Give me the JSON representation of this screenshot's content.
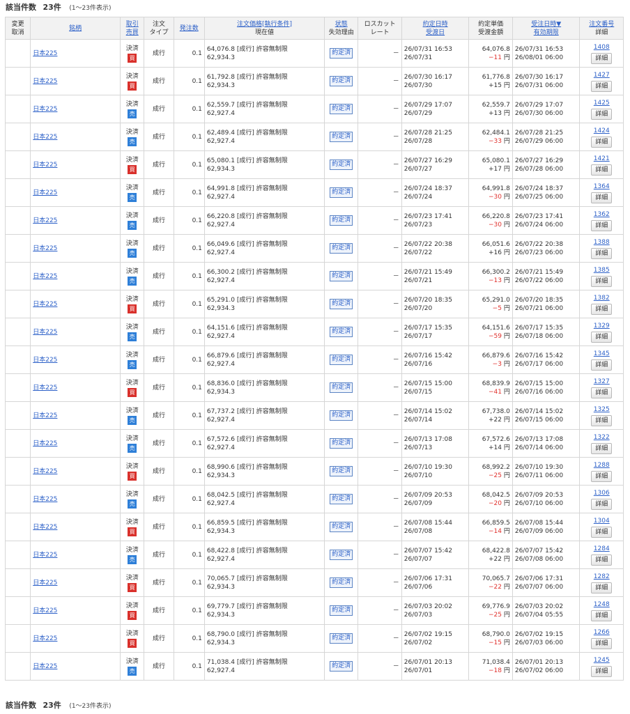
{
  "summary": {
    "label": "該当件数",
    "count": "23件",
    "range": "(1〜23件表示)"
  },
  "headers": {
    "change": [
      "変更",
      "取消"
    ],
    "symbol": "銘柄",
    "side": [
      "取引",
      "売買"
    ],
    "type": [
      "注文",
      "タイプ"
    ],
    "qty": "発注数",
    "price": [
      "注文価格[執行条件]",
      "現在値"
    ],
    "status": [
      "状態",
      "失効理由"
    ],
    "losscut": [
      "ロスカット",
      "レート"
    ],
    "exec_date": [
      "約定日時",
      "受渡日"
    ],
    "exec_price": [
      "約定単価",
      "受渡金額"
    ],
    "order_date": [
      "受注日時▼",
      "有効期限"
    ],
    "order_no": [
      "注文番号",
      "詳細"
    ]
  },
  "common": {
    "symbol": "日本225",
    "kesai": "決済",
    "buy": "買",
    "sell": "売",
    "type": "成行",
    "qty": "0.1",
    "condition": "[成行] 許容無制限",
    "status": "約定済",
    "losscut": "－",
    "yen": "円",
    "detail": "詳細"
  },
  "colors": {
    "buy": "#d9302b",
    "sell": "#2e7fd8",
    "link": "#2c60c8",
    "negative": "#e0312d"
  },
  "rows": [
    {
      "side": "buy",
      "price": "64,076.8",
      "current": "62,934.3",
      "exec_dt": "26/07/31 16:53",
      "settle": "26/07/31",
      "exec_price": "64,076.8",
      "pl": "−11",
      "neg": true,
      "order_dt": "26/07/31 16:53",
      "expiry": "26/08/01 06:00",
      "no": "1408"
    },
    {
      "side": "buy",
      "price": "61,792.8",
      "current": "62,934.3",
      "exec_dt": "26/07/30 16:17",
      "settle": "26/07/30",
      "exec_price": "61,776.8",
      "pl": "+15",
      "neg": false,
      "order_dt": "26/07/30 16:17",
      "expiry": "26/07/31 06:00",
      "no": "1427"
    },
    {
      "side": "sell",
      "price": "62,559.7",
      "current": "62,927.4",
      "exec_dt": "26/07/29 17:07",
      "settle": "26/07/29",
      "exec_price": "62,559.7",
      "pl": "+13",
      "neg": false,
      "order_dt": "26/07/29 17:07",
      "expiry": "26/07/30 06:00",
      "no": "1425"
    },
    {
      "side": "sell",
      "price": "62,489.4",
      "current": "62,927.4",
      "exec_dt": "26/07/28 21:25",
      "settle": "26/07/28",
      "exec_price": "62,484.1",
      "pl": "−33",
      "neg": true,
      "order_dt": "26/07/28 21:25",
      "expiry": "26/07/29 06:00",
      "no": "1424"
    },
    {
      "side": "buy",
      "price": "65,080.1",
      "current": "62,934.3",
      "exec_dt": "26/07/27 16:29",
      "settle": "26/07/27",
      "exec_price": "65,080.1",
      "pl": "+17",
      "neg": false,
      "order_dt": "26/07/27 16:29",
      "expiry": "26/07/28 06:00",
      "no": "1421"
    },
    {
      "side": "sell",
      "price": "64,991.8",
      "current": "62,927.4",
      "exec_dt": "26/07/24 18:37",
      "settle": "26/07/24",
      "exec_price": "64,991.8",
      "pl": "−30",
      "neg": true,
      "order_dt": "26/07/24 18:37",
      "expiry": "26/07/25 06:00",
      "no": "1364"
    },
    {
      "side": "sell",
      "price": "66,220.8",
      "current": "62,927.4",
      "exec_dt": "26/07/23 17:41",
      "settle": "26/07/23",
      "exec_price": "66,220.8",
      "pl": "−30",
      "neg": true,
      "order_dt": "26/07/23 17:41",
      "expiry": "26/07/24 06:00",
      "no": "1362"
    },
    {
      "side": "sell",
      "price": "66,049.6",
      "current": "62,927.4",
      "exec_dt": "26/07/22 20:38",
      "settle": "26/07/22",
      "exec_price": "66,051.6",
      "pl": "+16",
      "neg": false,
      "order_dt": "26/07/22 20:38",
      "expiry": "26/07/23 06:00",
      "no": "1388"
    },
    {
      "side": "sell",
      "price": "66,300.2",
      "current": "62,927.4",
      "exec_dt": "26/07/21 15:49",
      "settle": "26/07/21",
      "exec_price": "66,300.2",
      "pl": "−13",
      "neg": true,
      "order_dt": "26/07/21 15:49",
      "expiry": "26/07/22 06:00",
      "no": "1385"
    },
    {
      "side": "buy",
      "price": "65,291.0",
      "current": "62,934.3",
      "exec_dt": "26/07/20 18:35",
      "settle": "26/07/20",
      "exec_price": "65,291.0",
      "pl": "−5",
      "neg": true,
      "order_dt": "26/07/20 18:35",
      "expiry": "26/07/21 06:00",
      "no": "1382"
    },
    {
      "side": "sell",
      "price": "64,151.6",
      "current": "62,927.4",
      "exec_dt": "26/07/17 15:35",
      "settle": "26/07/17",
      "exec_price": "64,151.6",
      "pl": "−59",
      "neg": true,
      "order_dt": "26/07/17 15:35",
      "expiry": "26/07/18 06:00",
      "no": "1329"
    },
    {
      "side": "sell",
      "price": "66,879.6",
      "current": "62,927.4",
      "exec_dt": "26/07/16 15:42",
      "settle": "26/07/16",
      "exec_price": "66,879.6",
      "pl": "−3",
      "neg": true,
      "order_dt": "26/07/16 15:42",
      "expiry": "26/07/17 06:00",
      "no": "1345"
    },
    {
      "side": "buy",
      "price": "68,836.0",
      "current": "62,934.3",
      "exec_dt": "26/07/15 15:00",
      "settle": "26/07/15",
      "exec_price": "68,839.9",
      "pl": "−41",
      "neg": true,
      "order_dt": "26/07/15 15:00",
      "expiry": "26/07/16 06:00",
      "no": "1327"
    },
    {
      "side": "sell",
      "price": "67,737.2",
      "current": "62,927.4",
      "exec_dt": "26/07/14 15:02",
      "settle": "26/07/14",
      "exec_price": "67,738.0",
      "pl": "+22",
      "neg": false,
      "order_dt": "26/07/14 15:02",
      "expiry": "26/07/15 06:00",
      "no": "1325"
    },
    {
      "side": "sell",
      "price": "67,572.6",
      "current": "62,927.4",
      "exec_dt": "26/07/13 17:08",
      "settle": "26/07/13",
      "exec_price": "67,572.6",
      "pl": "+14",
      "neg": false,
      "order_dt": "26/07/13 17:08",
      "expiry": "26/07/14 06:00",
      "no": "1322"
    },
    {
      "side": "buy",
      "price": "68,990.6",
      "current": "62,934.3",
      "exec_dt": "26/07/10 19:30",
      "settle": "26/07/10",
      "exec_price": "68,992.2",
      "pl": "−25",
      "neg": true,
      "order_dt": "26/07/10 19:30",
      "expiry": "26/07/11 06:00",
      "no": "1288"
    },
    {
      "side": "sell",
      "price": "68,042.5",
      "current": "62,927.4",
      "exec_dt": "26/07/09 20:53",
      "settle": "26/07/09",
      "exec_price": "68,042.5",
      "pl": "−20",
      "neg": true,
      "order_dt": "26/07/09 20:53",
      "expiry": "26/07/10 06:00",
      "no": "1306"
    },
    {
      "side": "buy",
      "price": "66,859.5",
      "current": "62,934.3",
      "exec_dt": "26/07/08 15:44",
      "settle": "26/07/08",
      "exec_price": "66,859.5",
      "pl": "−14",
      "neg": true,
      "order_dt": "26/07/08 15:44",
      "expiry": "26/07/09 06:00",
      "no": "1304"
    },
    {
      "side": "sell",
      "price": "68,422.8",
      "current": "62,927.4",
      "exec_dt": "26/07/07 15:42",
      "settle": "26/07/07",
      "exec_price": "68,422.8",
      "pl": "+22",
      "neg": false,
      "order_dt": "26/07/07 15:42",
      "expiry": "26/07/08 06:00",
      "no": "1284"
    },
    {
      "side": "buy",
      "price": "70,065.7",
      "current": "62,934.3",
      "exec_dt": "26/07/06 17:31",
      "settle": "26/07/06",
      "exec_price": "70,065.7",
      "pl": "−22",
      "neg": true,
      "order_dt": "26/07/06 17:31",
      "expiry": "26/07/07 06:00",
      "no": "1282"
    },
    {
      "side": "buy",
      "price": "69,779.7",
      "current": "62,934.3",
      "exec_dt": "26/07/03 20:02",
      "settle": "26/07/03",
      "exec_price": "69,776.9",
      "pl": "−25",
      "neg": true,
      "order_dt": "26/07/03 20:02",
      "expiry": "26/07/04 05:55",
      "no": "1248"
    },
    {
      "side": "buy",
      "price": "68,790.0",
      "current": "62,934.3",
      "exec_dt": "26/07/02 19:15",
      "settle": "26/07/02",
      "exec_price": "68,790.0",
      "pl": "−15",
      "neg": true,
      "order_dt": "26/07/02 19:15",
      "expiry": "26/07/03 06:00",
      "no": "1266"
    },
    {
      "side": "sell",
      "price": "71,038.4",
      "current": "62,927.4",
      "exec_dt": "26/07/01 20:13",
      "settle": "26/07/01",
      "exec_price": "71,038.4",
      "pl": "−18",
      "neg": true,
      "order_dt": "26/07/01 20:13",
      "expiry": "26/07/02 06:00",
      "no": "1245"
    }
  ]
}
